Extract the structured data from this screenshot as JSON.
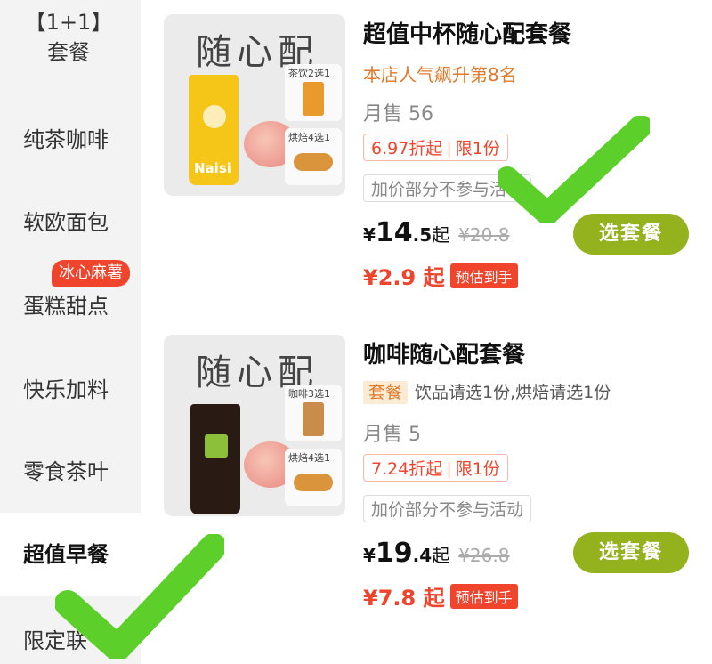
{
  "sidebar": {
    "items": [
      {
        "line1": "【1+1】",
        "line2": "套餐"
      },
      {
        "label": "纯茶咖啡"
      },
      {
        "label": "软欧面包"
      },
      {
        "label": "蛋糕甜点"
      },
      {
        "label": "快乐加料"
      },
      {
        "label": "零食茶叶"
      },
      {
        "label": "超值早餐"
      },
      {
        "label": "限定联"
      }
    ],
    "badge": "冰心麻薯",
    "active_index": 6
  },
  "products": [
    {
      "image_title": "随心配",
      "cup_logo": "Naisi",
      "mini1_label": "茶饮2选1",
      "mini2_label": "烘焙4选1",
      "title": "超值中杯随心配套餐",
      "subtitle": "本店人气飙升第8名",
      "sales": "月售 56",
      "discount": "6.97折起",
      "limit": "限1份",
      "note": "加价部分不参与活动",
      "currency": "¥",
      "price_int": "14",
      "price_dec": ".5",
      "price_suffix": "起",
      "original_price": "¥20.8",
      "est_amount": "¥2.9 起",
      "est_badge": "预估到手",
      "button": "选套餐"
    },
    {
      "image_title": "随心配",
      "mini1_label": "咖啡3选1",
      "mini2_label": "烘焙4选1",
      "title": "咖啡随心配套餐",
      "tag": "套餐",
      "tag_text": "饮品请选1份,烘焙请选1份",
      "sales": "月售 5",
      "discount": "7.24折起",
      "limit": "限1份",
      "note": "加价部分不参与活动",
      "currency": "¥",
      "price_int": "19",
      "price_dec": ".4",
      "price_suffix": "起",
      "original_price": "¥26.8",
      "est_amount": "¥7.8 起",
      "est_badge": "预估到手",
      "button": "选套餐"
    }
  ],
  "colors": {
    "accent_green": "#94b21e",
    "check_green": "#5ccf2a",
    "price_red": "#f0442c",
    "orange": "#e07a2a"
  }
}
